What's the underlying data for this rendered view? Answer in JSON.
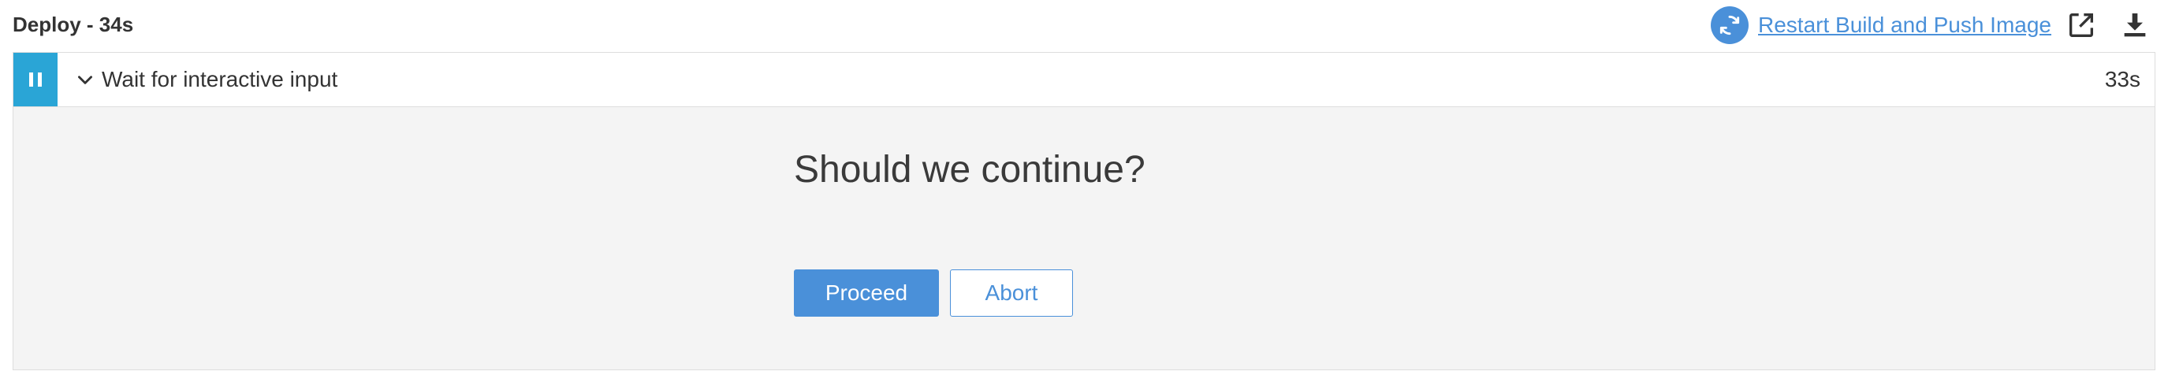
{
  "header": {
    "title": "Deploy - 34s",
    "restart_label": "Restart Build and Push Image",
    "restart_icon": "refresh-icon",
    "open_icon": "external-link-icon",
    "download_icon": "download-icon"
  },
  "step": {
    "status": "paused",
    "status_icon": "pause-icon",
    "toggle_icon": "chevron-down-icon",
    "label": "Wait for interactive input",
    "duration": "33s"
  },
  "input_prompt": {
    "message": "Should we continue?",
    "proceed_label": "Proceed",
    "abort_label": "Abort"
  },
  "colors": {
    "accent": "#4a90d9",
    "status_paused": "#2aa5d6",
    "panel_bg": "#f4f4f4"
  }
}
